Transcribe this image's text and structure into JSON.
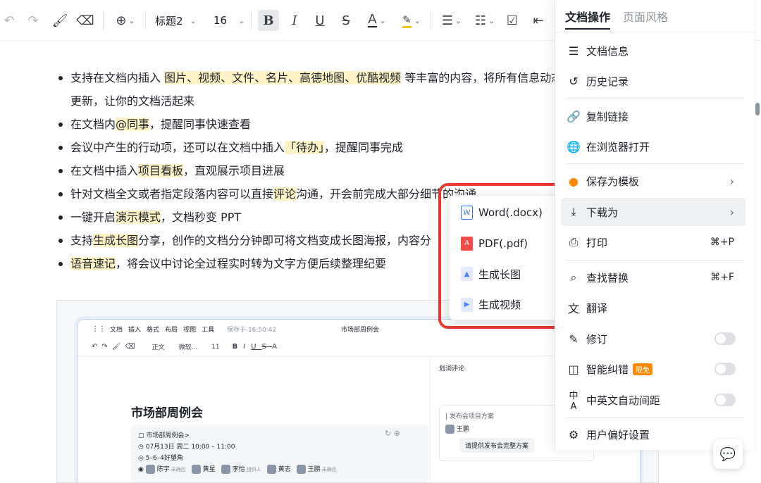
{
  "toolbar": {
    "undo": "↶",
    "redo": "↷",
    "format_painter": "🖌",
    "eraser": "⌫",
    "insert": "⊕",
    "heading": "标题2",
    "font_size": "16",
    "bold": "B",
    "italic": "I",
    "underline": "U",
    "strike": "S",
    "font_color": "A",
    "highlight": "✎",
    "bullet_list": "☰",
    "ordered_list": "☷",
    "checkbox": "☑",
    "indent": "⇤",
    "chevron": "⌄"
  },
  "bullets": [
    {
      "parts": [
        {
          "t": "支持在文档内插入 "
        },
        {
          "t": "图片、视频、文件、名片、高德地图、优酷视频",
          "hl": true
        },
        {
          "t": " 等丰富的内容，将所有信息动态更新，让你的文档活起来"
        }
      ],
      "wrap": true
    },
    {
      "parts": [
        {
          "t": "在文档内"
        },
        {
          "t": "@同事",
          "hl": true
        },
        {
          "t": "，提醒同事快速查看"
        }
      ]
    },
    {
      "parts": [
        {
          "t": "会议中产生的行动项，还可以在文档中插入"
        },
        {
          "t": "「待办」",
          "hl": true
        },
        {
          "t": "，提醒同事完成"
        }
      ]
    },
    {
      "parts": [
        {
          "t": "在文档中插入"
        },
        {
          "t": "项目看板",
          "hl": true
        },
        {
          "t": "，直观展示项目进展"
        }
      ]
    },
    {
      "parts": [
        {
          "t": "针对文档全文或者指定段落内容可以直接"
        },
        {
          "t": "评论",
          "hl": true
        },
        {
          "t": "沟通，开会前完成大部分细节的沟通"
        }
      ]
    },
    {
      "parts": [
        {
          "t": "一键开启"
        },
        {
          "t": "演示模式",
          "hl": true
        },
        {
          "t": "，文档秒变 PPT"
        }
      ]
    },
    {
      "parts": [
        {
          "t": "支持"
        },
        {
          "t": "生成长图",
          "hl": true
        },
        {
          "t": "分享，创作的文档分分钟即可将文档变成长图海报，内容分"
        }
      ]
    },
    {
      "parts": [
        {
          "t": "语音速记",
          "hl": true
        },
        {
          "t": "，将会议中讨论全过程实时转为文字方便后续整理纪要"
        }
      ]
    }
  ],
  "embed": {
    "menus": [
      "文档",
      "插入",
      "格式",
      "布局",
      "视图",
      "工具"
    ],
    "saved": "保存于 16:50:42",
    "doc_title": "市场部周例会",
    "toolbar_text": [
      "正文",
      "微软...",
      "11"
    ],
    "title": "市场部周例会",
    "card": {
      "meeting": "市场部周例会>",
      "time": "07月13日 周二 10:00 – 11:00",
      "place": "5–6–4好望角",
      "people": [
        {
          "name": "陈宇",
          "note": "未确应"
        },
        {
          "name": "黄星",
          "note": ""
        },
        {
          "name": "李怡",
          "note": "组织人"
        },
        {
          "name": "黄志",
          "note": ""
        },
        {
          "name": "王鹏",
          "note": "未确应"
        }
      ]
    },
    "side_title": "划词评论",
    "comment": {
      "quote": "发布会项目方案",
      "user": "王鹏",
      "text": "请提供发布会完整方案"
    }
  },
  "submenu": {
    "items": [
      {
        "label": "Word(.docx)",
        "icon": "word-icon",
        "color": "#3370ff",
        "glyph": "W"
      },
      {
        "label": "PDF(.pdf)",
        "icon": "pdf-icon",
        "color": "#f54a45",
        "glyph": "A"
      },
      {
        "label": "生成长图",
        "icon": "image-icon",
        "color": "#4e83fd",
        "glyph": "▲"
      },
      {
        "label": "生成视频",
        "icon": "video-icon",
        "color": "#4e83fd",
        "glyph": "▶"
      }
    ]
  },
  "panel": {
    "tab_active": "文档操作",
    "tab_inactive": "页面风格",
    "items": {
      "info": "文档信息",
      "history": "历史记录",
      "copy_link": "复制链接",
      "browser": "在浏览器打开",
      "template": "保存为模板",
      "download": "下载为",
      "print": "打印",
      "print_shortcut": "⌘+P",
      "find": "查找替换",
      "find_shortcut": "⌘+F",
      "translate": "翻译",
      "revise": "修订",
      "smart": "智能纠错",
      "smart_badge": "限免",
      "spacing": "中英文自动间距",
      "prefs": "用户偏好设置"
    }
  },
  "colors": {
    "highlight": "#fdf3c7",
    "annotation_red": "#e8382f",
    "badge_orange": "#ff8800"
  }
}
